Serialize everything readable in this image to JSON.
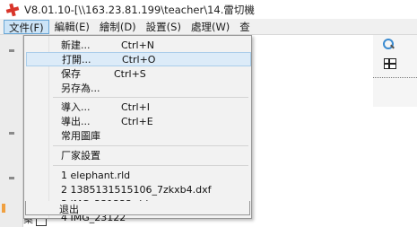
{
  "window": {
    "title": "V8.01.10-[\\\\163.23.81.199\\teacher\\14.雷切機",
    "icon": "app-logo-icon"
  },
  "menubar": [
    {
      "label": "文件(F)",
      "open": true
    },
    {
      "label": "編輯(E)"
    },
    {
      "label": "繪制(D)"
    },
    {
      "label": "設置(S)"
    },
    {
      "label": "處理(W)"
    },
    {
      "label": "查"
    }
  ],
  "file_menu": {
    "items": [
      {
        "label": "新建...",
        "shortcut": "Ctrl+N"
      },
      {
        "label": "打開...",
        "shortcut": "Ctrl+O",
        "highlighted": true
      },
      {
        "label": "保存",
        "shortcut": "Ctrl+S"
      },
      {
        "label": "另存為...",
        "shortcut": ""
      },
      {
        "label": "導入...",
        "shortcut": "Ctrl+I"
      },
      {
        "label": "導出...",
        "shortcut": "Ctrl+E"
      },
      {
        "label": "常用圖庫",
        "shortcut": ""
      },
      {
        "label": "厂家設置",
        "shortcut": ""
      },
      {
        "label": "1 elephant.rld",
        "shortcut": ""
      },
      {
        "label": "2 1385131515106_7zkxb4.dxf",
        "shortcut": ""
      },
      {
        "label": "3 IMG_231222.rld",
        "shortcut": ""
      },
      {
        "label": "4 IMG_23122",
        "shortcut": ""
      },
      {
        "label": "退出",
        "shortcut": ""
      }
    ]
  },
  "toolbar_right": {
    "icons": [
      "zoom-icon",
      "grid-icon"
    ]
  },
  "bottom": {
    "text": "案"
  }
}
